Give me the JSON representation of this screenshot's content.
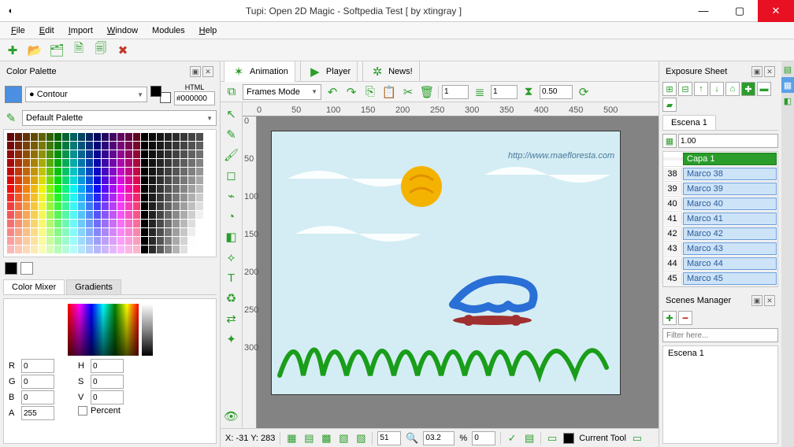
{
  "window": {
    "title": "Tupi: Open 2D Magic - Softpedia Test [ by xtingray ]",
    "min": "—",
    "max": "▢",
    "close": "✕"
  },
  "menus": [
    "File",
    "Edit",
    "Import",
    "Window",
    "Modules",
    "Help"
  ],
  "color_palette": {
    "title": "Color Palette",
    "contour_label": "Contour",
    "html_label": "HTML",
    "html_value": "#000000",
    "default_label": "Default Palette",
    "tab_mixer": "Color Mixer",
    "tab_gradients": "Gradients",
    "R_label": "R",
    "G_label": "G",
    "B_label": "B",
    "A_label": "A",
    "H_label": "H",
    "S_label": "S",
    "V_label": "V",
    "R": "0",
    "G": "0",
    "B": "0",
    "A": "255",
    "H": "0",
    "S": "0",
    "V": "0",
    "percent_label": "Percent"
  },
  "center_tabs": {
    "animation": "Animation",
    "player": "Player",
    "news": "News!"
  },
  "frames_toolbar": {
    "mode": "Frames Mode",
    "spin1": "1",
    "spin2": "1",
    "spin3": "0.50"
  },
  "ruler_h": [
    "0",
    "50",
    "100",
    "150",
    "200",
    "250",
    "300",
    "350",
    "400",
    "450",
    "500"
  ],
  "ruler_v": [
    "0",
    "50",
    "100",
    "150",
    "200",
    "250",
    "300"
  ],
  "paper_url": "http://www.maefloresta.com",
  "status": {
    "coords": "X: -31 Y: 283",
    "v1": "51",
    "v2": "03.2",
    "pct": "%",
    "v3": "0",
    "current_tool": "Current Tool"
  },
  "exposure": {
    "title": "Exposure Sheet",
    "tab": "Escena 1",
    "scale": "1.00",
    "layer": "Capa 1",
    "rows": [
      {
        "n": "38",
        "label": "Marco 38"
      },
      {
        "n": "39",
        "label": "Marco 39"
      },
      {
        "n": "40",
        "label": "Marco 40"
      },
      {
        "n": "41",
        "label": "Marco 41"
      },
      {
        "n": "42",
        "label": "Marco 42"
      },
      {
        "n": "43",
        "label": "Marco 43"
      },
      {
        "n": "44",
        "label": "Marco 44"
      },
      {
        "n": "45",
        "label": "Marco 45"
      }
    ]
  },
  "scenes": {
    "title": "Scenes Manager",
    "filter_ph": "Filter here...",
    "item": "Escena 1"
  }
}
